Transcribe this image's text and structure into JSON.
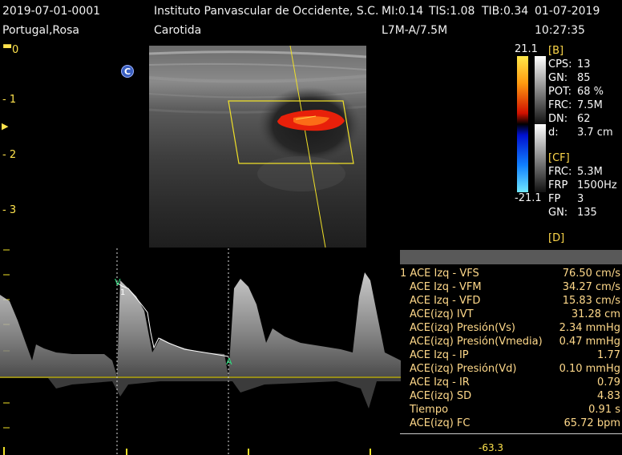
{
  "header": {
    "patient_id": "2019-07-01-0001",
    "patient_name": "Portugal,Rosa",
    "institution": "Instituto Panvascular de Occidente, S.C.",
    "mi": "MI:0.14",
    "tis": "TIS:1.08",
    "tib": "TIB:0.34",
    "date": "01-07-2019",
    "exam": "Carotida",
    "probe": "L7M-A/7.5M",
    "time": "10:27:35"
  },
  "depth_scale": [
    "0",
    "1",
    "2",
    "3"
  ],
  "badge": "C",
  "color_bar": {
    "max": "21.1",
    "min": "-21.1"
  },
  "b_params": {
    "section": "[B]",
    "rows": [
      {
        "label": "CPS:",
        "value": "13"
      },
      {
        "label": "GN:",
        "value": "85"
      },
      {
        "label": "POT:",
        "value": "68 %"
      },
      {
        "label": "FRC:",
        "value": "7.5M"
      },
      {
        "label": "DN:",
        "value": "62"
      },
      {
        "label": "d:",
        "value": "3.7 cm"
      }
    ]
  },
  "cf_params": {
    "section": "[CF]",
    "rows": [
      {
        "label": "FRC:",
        "value": "5.3M"
      },
      {
        "label": "FRP",
        "value": "1500Hz"
      },
      {
        "label": "FP",
        "value": "3"
      },
      {
        "label": "GN:",
        "value": "135"
      }
    ]
  },
  "d_params": {
    "section": "[D]"
  },
  "measurements": [
    {
      "label": "1 ACE Izq - VFS",
      "value": "76.50 cm/s"
    },
    {
      "label": "ACE Izq - VFM",
      "value": "34.27 cm/s"
    },
    {
      "label": "ACE Izq - VFD",
      "value": "15.83 cm/s"
    },
    {
      "label": "ACE(izq) IVT",
      "value": "31.28 cm"
    },
    {
      "label": "ACE(izq) Presión(Vs)",
      "value": "2.34 mmHg"
    },
    {
      "label": "ACE(izq) Presión(Vmedia)",
      "value": "0.47 mmHg"
    },
    {
      "label": "ACE Izq - IP",
      "value": "1.77"
    },
    {
      "label": "ACE(izq) Presión(Vd)",
      "value": "0.10 mmHg"
    },
    {
      "label": "ACE Izq - IR",
      "value": "0.79"
    },
    {
      "label": "ACE(izq) SD",
      "value": "4.83"
    },
    {
      "label": "Tiempo",
      "value": "0.91 s"
    },
    {
      "label": "ACE(izq) FC",
      "value": "65.72 bpm"
    }
  ],
  "bottom_value": "-63.3",
  "colors": {
    "accent_yellow": "#ffe34d",
    "text": "#f2f2f2",
    "measure_text": "#ffd98a",
    "flow_red": "#e8200a"
  }
}
